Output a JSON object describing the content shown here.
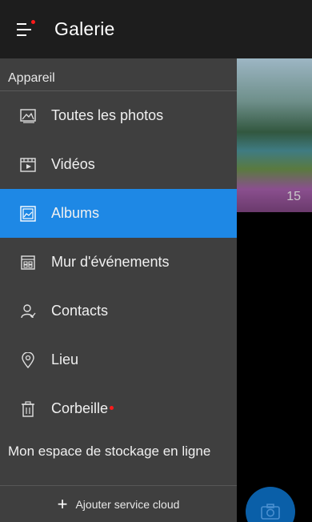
{
  "appbar": {
    "title": "Galerie",
    "menu_icon": "hamburger-icon",
    "notification_dot_color": "#ff1a1a"
  },
  "drawer": {
    "section_header": "Appareil",
    "items": [
      {
        "label": "Toutes les photos",
        "icon": "photos-icon",
        "active": false
      },
      {
        "label": "Vidéos",
        "icon": "video-icon",
        "active": false
      },
      {
        "label": "Albums",
        "icon": "albums-icon",
        "active": true
      },
      {
        "label": "Mur d'événements",
        "icon": "events-icon",
        "active": false
      },
      {
        "label": "Contacts",
        "icon": "contacts-icon",
        "active": false
      },
      {
        "label": "Lieu",
        "icon": "location-icon",
        "active": false
      },
      {
        "label": "Corbeille",
        "icon": "trash-icon",
        "active": false,
        "badge": "red-dot"
      }
    ],
    "cloud_header": "Mon espace de stockage en ligne",
    "add_cloud_label": "Ajouter service cloud"
  },
  "background": {
    "album_count": "15"
  },
  "colors": {
    "active_item": "#1e88e5",
    "drawer_bg": "#3f3f3f",
    "appbar_bg": "#1d1d1d",
    "fab": "#0a5fa8"
  }
}
